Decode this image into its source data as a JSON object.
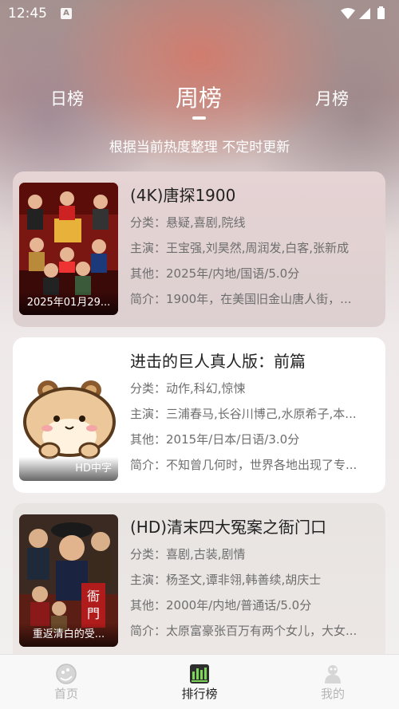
{
  "status_bar": {
    "time": "12:45",
    "notification_icon": "A"
  },
  "tabs": [
    {
      "label": "日榜"
    },
    {
      "label": "周榜"
    },
    {
      "label": "月榜"
    }
  ],
  "subtitle": "根据当前热度整理 不定时更新",
  "items": [
    {
      "title": "(4K)唐探1900",
      "poster_caption": "2025年01月29...",
      "genre": "分类：悬疑,喜剧,院线",
      "cast": "主演：王宝强,刘昊然,周润发,白客,张新成",
      "other": "其他：2025年/内地/国语/5.0分",
      "intro": "简介：1900年，在美国旧金山唐人街，..."
    },
    {
      "title": "进击的巨人真人版：前篇",
      "poster_caption": "HD中字",
      "genre": "分类：动作,科幻,惊悚",
      "cast": "主演：三浦春马,长谷川博己,水原希子,本...",
      "other": "其他：2015年/日本/日语/3.0分",
      "intro": "简介：不知曾几何时，世界各地出现了专..."
    },
    {
      "title": "(HD)清末四大冤案之衙门口",
      "poster_caption": "重返清白的受...",
      "genre": "分类：喜剧,古装,剧情",
      "cast": "主演：杨圣文,谭非翎,韩善续,胡庆士",
      "other": "其他：2000年/内地/普通话/5.0分",
      "intro": "简介：太原富豪张百万有两个女儿，大女..."
    }
  ],
  "bottom_nav": [
    {
      "label": "首页",
      "icon": "home-icon"
    },
    {
      "label": "排行榜",
      "icon": "ranking-icon"
    },
    {
      "label": "我的",
      "icon": "profile-icon"
    }
  ],
  "colors": {
    "accent": "#222222",
    "inactive": "#b5b5b5",
    "ranking_icon_bg": "#2e2e2e",
    "ranking_icon_bar": "#7cd65a"
  }
}
